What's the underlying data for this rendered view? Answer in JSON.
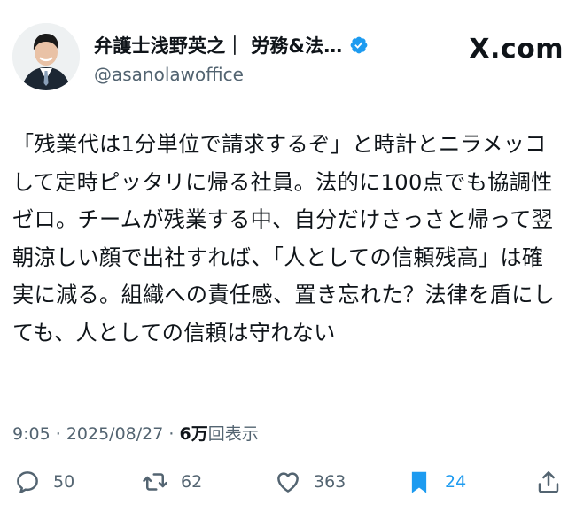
{
  "author": {
    "display_name": "弁護士浅野英之｜ 労務&法…",
    "handle": "@asanolawoffice",
    "verified": true
  },
  "site": {
    "label": "X.com"
  },
  "tweet": {
    "text": "「残業代は1分単位で請求するぞ」と時計とニラメッコして定時ピッタリに帰る社員。法的に100点でも協調性ゼロ。チームが残業する中、自分だけさっさと帰って翌朝涼しい顔で出社すれば、「人としての信頼残高」は確実に減る。組織への責任感、置き忘れた？法律を盾にしても、人としての信頼は守れない"
  },
  "meta": {
    "time": "9:05",
    "date": "2025/08/27",
    "separator": "·",
    "views_count": "6万",
    "views_label": "回表示"
  },
  "actions": {
    "reply_count": "50",
    "repost_count": "62",
    "like_count": "363",
    "bookmark_count": "24"
  },
  "colors": {
    "accent": "#1d9bf0",
    "text": "#0f1419",
    "secondary": "#536471"
  },
  "icons": [
    "reply-icon",
    "repost-icon",
    "like-icon",
    "bookmark-icon",
    "share-icon",
    "verified-badge-icon"
  ]
}
